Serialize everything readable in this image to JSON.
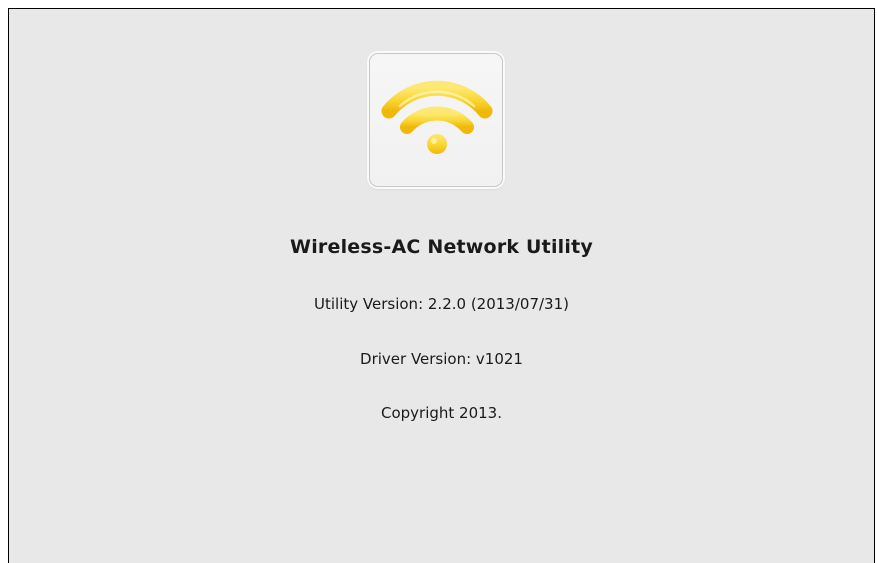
{
  "about": {
    "title": "Wireless-AC Network Utility",
    "utility_version": "Utility Version: 2.2.0 (2013/07/31)",
    "driver_version": "Driver Version: v1021",
    "copyright": "Copyright 2013."
  },
  "icon": {
    "name": "wifi-icon",
    "color_main": "#f7c613",
    "color_light": "#fde873"
  }
}
